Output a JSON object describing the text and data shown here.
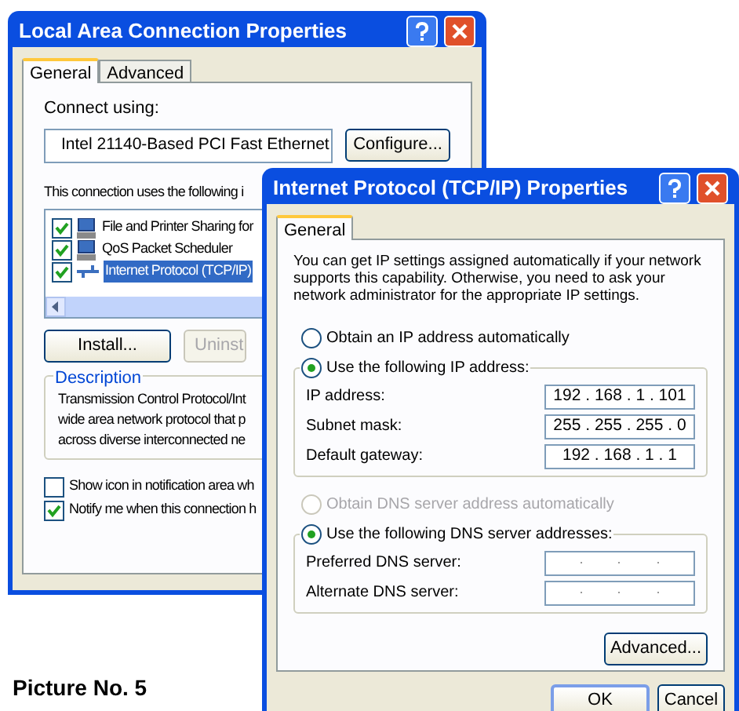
{
  "back_window": {
    "title": "Local Area Connection Properties",
    "tabs": [
      {
        "label": "General",
        "selected": true
      },
      {
        "label": "Advanced",
        "selected": false
      }
    ],
    "connect_using_label": "Connect using:",
    "adapter": "Intel 21140-Based PCI Fast Ethernet",
    "configure_button": "Configure...",
    "components_label": "This connection uses the following i",
    "components": [
      {
        "label": "File and Printer Sharing for",
        "checked": true,
        "selected": false,
        "kind": "service"
      },
      {
        "label": "QoS Packet Scheduler",
        "checked": true,
        "selected": false,
        "kind": "service"
      },
      {
        "label": "Internet Protocol (TCP/IP)",
        "checked": true,
        "selected": true,
        "kind": "protocol"
      }
    ],
    "buttons": [
      {
        "label": "Install...",
        "disabled": false
      },
      {
        "label": "Uninst",
        "disabled": true
      }
    ],
    "description_title": "Description",
    "description_lines": [
      "Transmission Control Protocol/Int",
      "wide area network protocol that p",
      "across diverse interconnected ne"
    ],
    "options": [
      {
        "label": "Show icon in notification area wh",
        "checked": false
      },
      {
        "label": "Notify me when this connection h",
        "checked": true
      }
    ]
  },
  "front_window": {
    "title": "Internet Protocol (TCP/IP) Properties",
    "tabs": [
      {
        "label": "General",
        "selected": true
      }
    ],
    "intro": "You can get IP settings assigned automatically if your network supports this capability. Otherwise, you need to ask your network administrator for the appropriate IP settings.",
    "ip_modes": [
      {
        "label": "Obtain an IP address automatically",
        "selected": false,
        "disabled": false
      },
      {
        "label": "Use the following IP address:",
        "selected": true,
        "disabled": false
      }
    ],
    "ip_fields": [
      {
        "label": "IP address:",
        "value": "192 . 168 . 1 . 101"
      },
      {
        "label": "Subnet mask:",
        "value": "255 . 255 . 255 . 0"
      },
      {
        "label": "Default gateway:",
        "value": "192 . 168 . 1 . 1"
      }
    ],
    "dns_modes": [
      {
        "label": "Obtain DNS server address automatically",
        "selected": false,
        "disabled": true
      },
      {
        "label": "Use the following DNS server addresses:",
        "selected": true,
        "disabled": false
      }
    ],
    "dns_fields": [
      {
        "label": "Preferred DNS server:"
      },
      {
        "label": "Alternate DNS server:"
      }
    ],
    "advanced_button": "Advanced...",
    "buttons": [
      "OK",
      "Cancel"
    ]
  },
  "caption": "Picture No. 5"
}
